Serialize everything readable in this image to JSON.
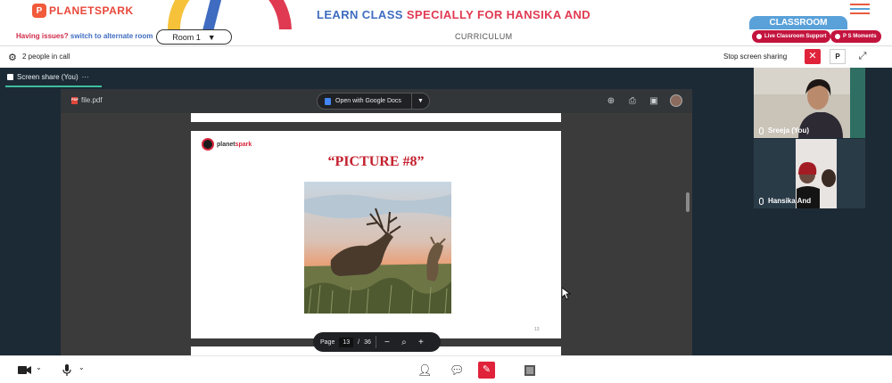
{
  "header": {
    "logo_text": "PLANETSPARK",
    "title_part1": "LEARN CLASS ",
    "title_part2": "SPECIALLY FOR HANSIKA AND",
    "classroom_label": "CLASSROOM"
  },
  "subbar": {
    "issues_text": "Having issues?",
    "alternate_link": "switch to alternate room",
    "room_label": "Room 1",
    "room_caret": "▼",
    "curriculum_label": "CURRICULUM",
    "live_support_label": "Live Classroom Support",
    "ps_moments_label": "P S Moments"
  },
  "callbar": {
    "people_text": "2 people in call",
    "stop_sharing_label": "Stop screen sharing",
    "p_label": "P"
  },
  "stage": {
    "share_tab_label": "Screen share (You)",
    "share_tab_more": "···"
  },
  "pdf": {
    "file_name": "file.pdf",
    "open_with_label": "Open with Google Docs",
    "logo_text_a": "planet",
    "logo_text_b": "spark",
    "picture_title": "“PICTURE #8”",
    "slide_number": "13",
    "page_label": "Page",
    "current_page": "13",
    "page_sep": "/",
    "total_pages": "36",
    "zoom_out_label": "−",
    "zoom_in_label": "+"
  },
  "participants": [
    {
      "name": "Sreeja (You)"
    },
    {
      "name": "Hansika And"
    }
  ],
  "colors": {
    "brand_red": "#e03a52",
    "brand_blue": "#3f6cc0",
    "stage_bg": "#1c2a35",
    "accent_teal": "#3fbf9f"
  }
}
